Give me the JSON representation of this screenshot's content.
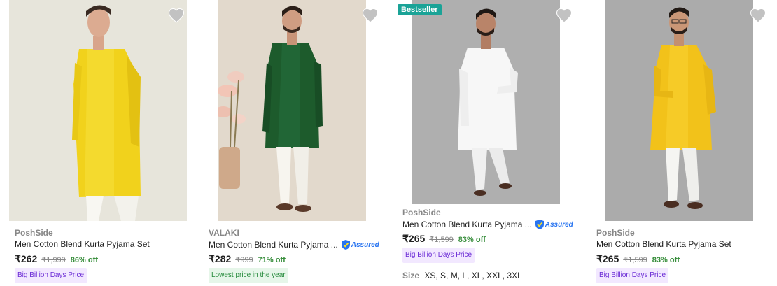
{
  "products": [
    {
      "brand": "PoshSide",
      "title": "Men Cotton Blend Kurta Pyjama Set",
      "price": "₹262",
      "mrp": "₹1,999",
      "discount": "86% off",
      "tag": "Big Billion Days Price",
      "assured": false,
      "image": "yellow kurta model"
    },
    {
      "brand": "VALAKI",
      "title": "Men Cotton Blend Kurta Pyjama ...",
      "price": "₹282",
      "mrp": "₹999",
      "discount": "71% off",
      "tag": "Lowest price in the year",
      "assured": true,
      "assured_label": "Assured",
      "image": "green kurta model"
    },
    {
      "badge": "Bestseller",
      "brand": "PoshSide",
      "title": "Men Cotton Blend Kurta Pyjama ...",
      "price": "₹265",
      "mrp": "₹1,599",
      "discount": "83% off",
      "tag": "Big Billion Days Price",
      "assured": true,
      "assured_label": "Assured",
      "size_label": "Size",
      "sizes": "XS, S, M, L, XL, XXL, 3XL",
      "image": "white kurta model"
    },
    {
      "brand": "PoshSide",
      "title": "Men Cotton Blend Kurta Pyjama Set",
      "price": "₹265",
      "mrp": "₹1,599",
      "discount": "83% off",
      "tag": "Big Billion Days Price",
      "assured": false,
      "image": "yellow kurta model"
    }
  ],
  "icons": {
    "wishlist": "heart-icon",
    "assured": "assured-shield-icon"
  },
  "colors": {
    "discount": "#388e3c",
    "bestseller": "#1aa397",
    "bbd_bg": "#f2e8ff",
    "bbd_text": "#6b2bd6",
    "low_bg": "#e6f6e9",
    "low_text": "#258a3b",
    "assured": "#2874f0"
  }
}
